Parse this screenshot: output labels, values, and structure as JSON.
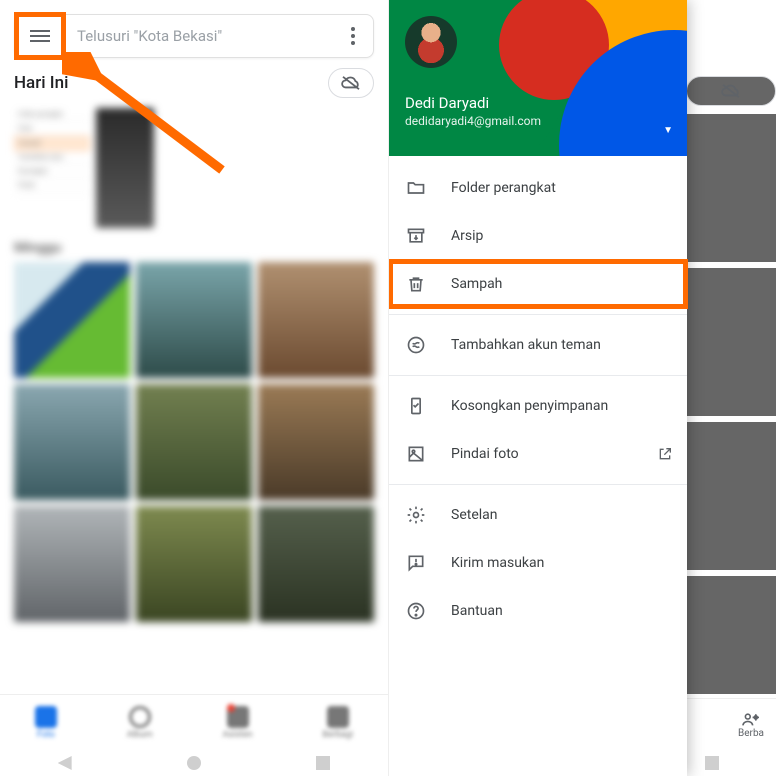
{
  "left": {
    "search_placeholder": "Telusuri \"Kota Bekasi\"",
    "today_label": "Hari Ini",
    "week_label": "Minggu",
    "mini_menu": [
      "Folder perangkat",
      "Arsip",
      "Sampah",
      "Tambahkan akun",
      "Kosongkan",
      "Pindai"
    ],
    "tabs": [
      "Foto",
      "Album",
      "Asisten",
      "Berbagi"
    ]
  },
  "right": {
    "user_name": "Dedi Daryadi",
    "user_email": "dedidaryadi4@gmail.com",
    "menu": {
      "folder": "Folder perangkat",
      "archive": "Arsip",
      "trash": "Sampah",
      "add_account": "Tambahkan akun teman",
      "free_up": "Kosongkan penyimpanan",
      "scan": "Pindai foto",
      "settings": "Setelan",
      "feedback": "Kirim masukan",
      "help": "Bantuan"
    },
    "share_tab": "Berba"
  },
  "highlight_color": "#ff6a00"
}
